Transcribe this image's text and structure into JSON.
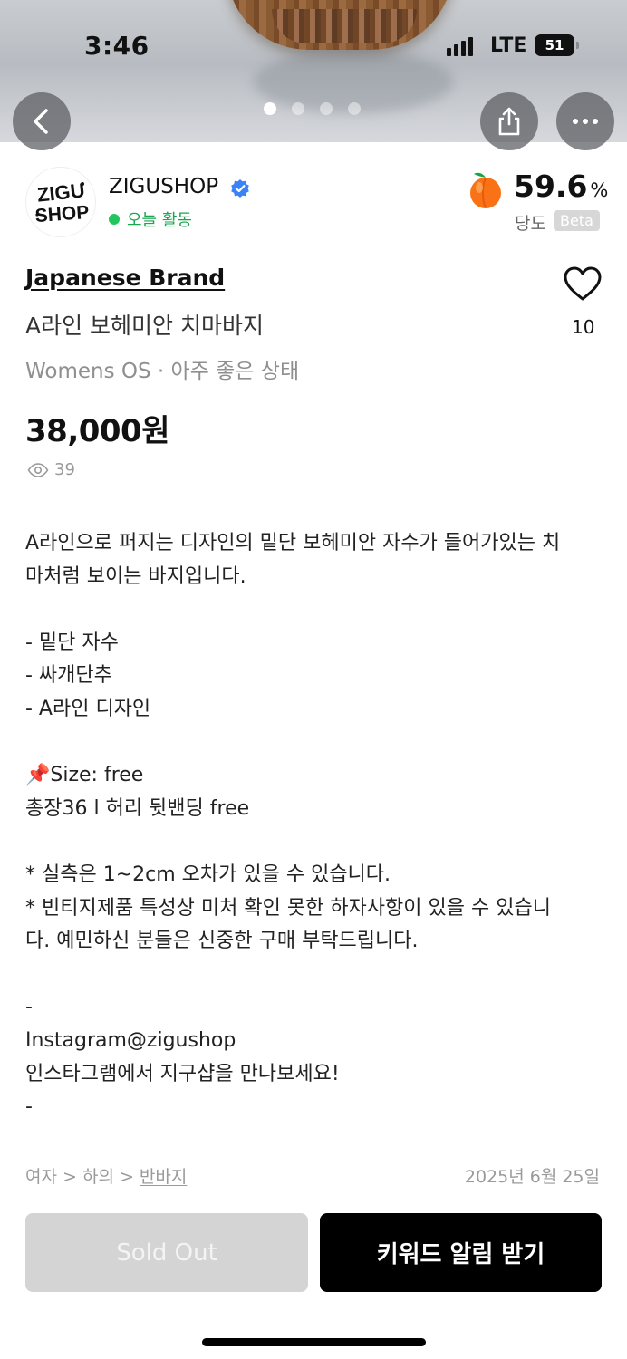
{
  "status_bar": {
    "time": "3:46",
    "network": "LTE",
    "battery": "51"
  },
  "hero": {
    "page_count": 4,
    "active_index": 0
  },
  "seller": {
    "name": "ZIGUSHOP",
    "activity": "오늘 활동",
    "logo_text": "ZIGU SHOP",
    "score": "59.6",
    "score_unit": "%",
    "score_label": "당도",
    "score_badge": "Beta"
  },
  "product": {
    "brand": "Japanese Brand",
    "title": "A라인 보헤미안 치마바지",
    "condition": "Womens OS · 아주 좋은 상태",
    "price": "38,000원",
    "views": "39",
    "likes": "10"
  },
  "description": [
    "A라인으로 퍼지는 디자인의 밑단 보헤미안 자수가 들어가있는 치",
    "마처럼 보이는 바지입니다.",
    "",
    "- 밑단 자수",
    "- 싸개단추",
    "- A라인 디자인",
    "",
    "📌Size: free",
    "총장36 l 허리 뒷밴딩 free",
    "",
    "*  실측은 1~2cm 오차가 있을 수 있습니다.",
    "*   빈티지제품 특성상 미처 확인 못한 하자사항이 있을 수 있습니",
    "다. 예민하신 분들은 신중한 구매 부탁드립니다.",
    "",
    "-",
    "Instagram@zigushop",
    "인스타그램에서 지구샵을 만나보세요!",
    "-"
  ],
  "footer": {
    "breadcrumb_prefix": "여자 > 하의 > ",
    "breadcrumb_link": "반바지",
    "date": "2025년 6월 25일",
    "sold_out_label": "Sold Out",
    "keyword_alert_label": "키워드 알림 받기"
  },
  "colors": {
    "activity_green": "#22c55e",
    "verified_blue": "#3b82f6",
    "peach": "#f97316"
  }
}
